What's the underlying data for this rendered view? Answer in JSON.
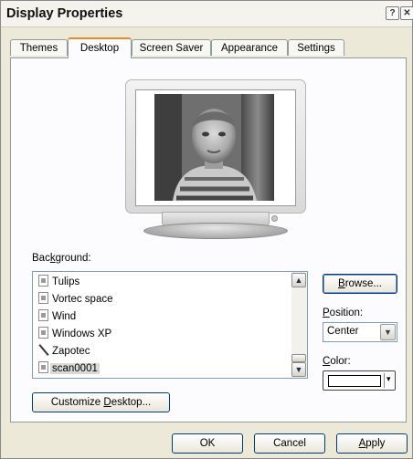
{
  "window": {
    "title": "Display Properties",
    "help_glyph": "?",
    "close_glyph": "✕"
  },
  "tabs": [
    {
      "label": "Themes",
      "active": false
    },
    {
      "label": "Desktop",
      "active": true
    },
    {
      "label": "Screen Saver",
      "active": false
    },
    {
      "label": "Appearance",
      "active": false
    },
    {
      "label": "Settings",
      "active": false
    }
  ],
  "background": {
    "label_pre": "Bac",
    "label_u": "k",
    "label_post": "ground:",
    "items": [
      {
        "label": "Tulips",
        "icon": "file-image-icon"
      },
      {
        "label": "Vortec space",
        "icon": "file-image-icon"
      },
      {
        "label": "Wind",
        "icon": "file-image-icon"
      },
      {
        "label": "Windows XP",
        "icon": "file-image-icon"
      },
      {
        "label": "Zapotec",
        "icon": "pen-icon"
      },
      {
        "label": "scan0001",
        "icon": "file-image-icon",
        "selected": true
      }
    ],
    "scroll_up_glyph": "▲",
    "scroll_down_glyph": "▼"
  },
  "browse": {
    "pre": "",
    "u": "B",
    "post": "rowse..."
  },
  "position": {
    "label_pre": "",
    "label_u": "P",
    "label_post": "osition:",
    "value": "Center",
    "arrow_glyph": "▼"
  },
  "color": {
    "label_pre": "",
    "label_u": "C",
    "label_post": "olor:",
    "swatch": "#ffffff",
    "arrow_glyph": "▾"
  },
  "customize": {
    "pre": "Customize ",
    "u": "D",
    "post": "esktop..."
  },
  "footer": {
    "ok": "OK",
    "cancel": "Cancel",
    "apply_u": "A",
    "apply_post": "pply"
  }
}
